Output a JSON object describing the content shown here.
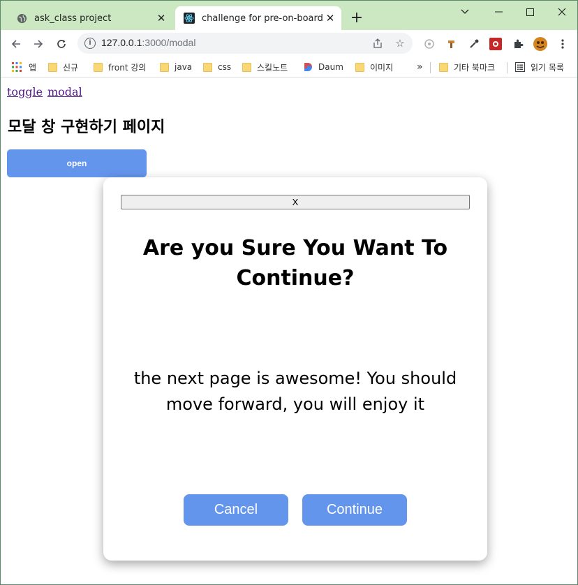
{
  "browser": {
    "tabs": [
      {
        "title": "ask_class project",
        "active": false,
        "icon": "globe-icon"
      },
      {
        "title": "challenge for pre-on-board",
        "active": true,
        "icon": "react-icon"
      }
    ],
    "url_host": "127.0.0.1",
    "url_path": ":3000/modal",
    "bookmarks": [
      {
        "label": "앱",
        "icon": "apps-grid-icon"
      },
      {
        "label": "신규",
        "icon": "folder-icon"
      },
      {
        "label": "front 강의",
        "icon": "folder-icon"
      },
      {
        "label": "java",
        "icon": "folder-icon"
      },
      {
        "label": "css",
        "icon": "folder-icon"
      },
      {
        "label": "스킬노트",
        "icon": "folder-icon"
      },
      {
        "label": "Daum",
        "icon": "daum-icon"
      },
      {
        "label": "이미지",
        "icon": "folder-icon"
      }
    ],
    "bookmarks_overflow": "»",
    "other_bookmarks": "기타 북마크",
    "reading_list": "읽기 목록"
  },
  "page": {
    "links": [
      "toggle",
      "modal"
    ],
    "title": "모달 창 구현하기 페이지",
    "open_button": "open"
  },
  "modal": {
    "close_label": "X",
    "title": "Are you Sure You Want To Continue?",
    "body": "the next page is awesome! You should move forward, you will enjoy it",
    "cancel_label": "Cancel",
    "continue_label": "Continue"
  },
  "colors": {
    "accent": "#6495ed",
    "tabbar": "#cbe8c2"
  }
}
